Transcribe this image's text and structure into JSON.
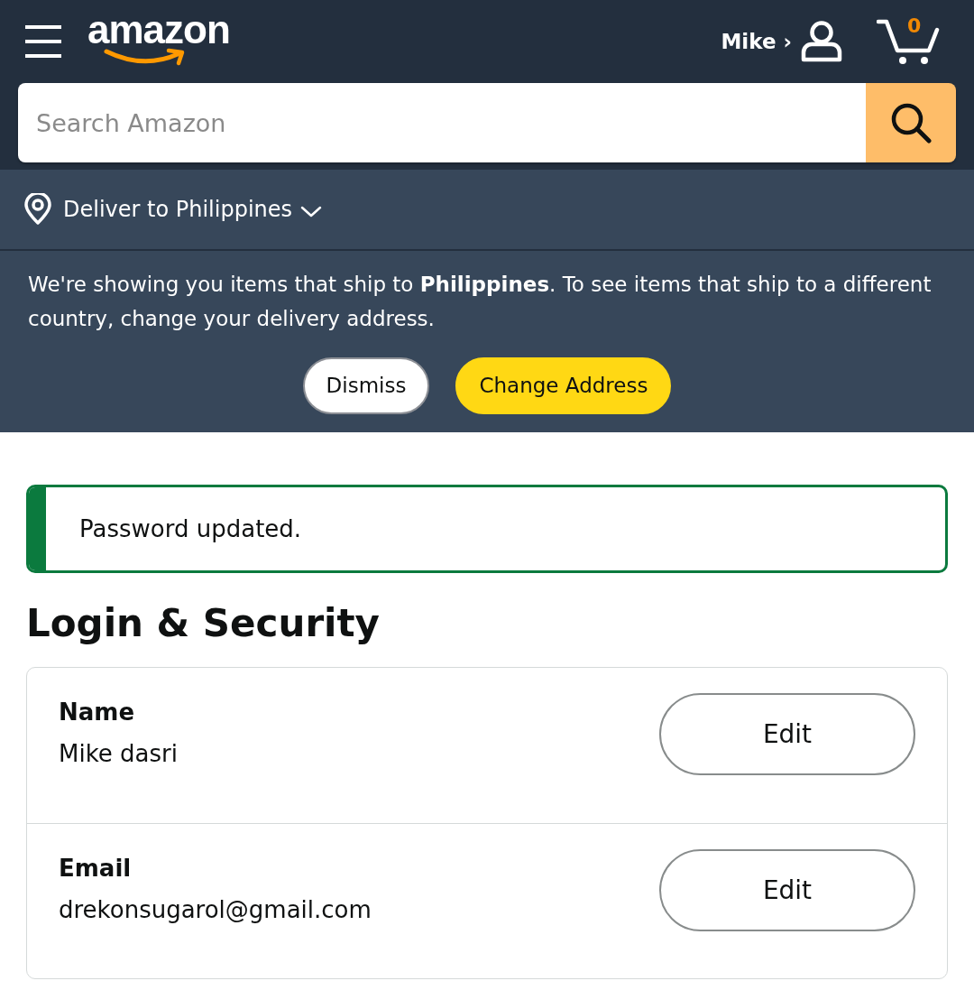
{
  "header": {
    "logo": "amazon",
    "account": "Mike ›",
    "cart_count": "0"
  },
  "search": {
    "placeholder": "Search Amazon"
  },
  "delivery": {
    "label": "Deliver to Philippines"
  },
  "location_notice": {
    "message": "We're showing you items that ship to **Philippines**. To see items that ship to a different country, change your delivery address.",
    "buttons": [
      {
        "label": "Dismiss",
        "kind": "secondary"
      },
      {
        "label": "Change Address",
        "kind": "primary"
      }
    ]
  },
  "alert": {
    "kind": "success",
    "message": "Password updated."
  },
  "page_title": "Login & Security",
  "settings": [
    {
      "label": "Name",
      "value": "Mike dasri",
      "button": "Edit"
    },
    {
      "label": "Email",
      "value": "drekonsugarol@gmail.com",
      "button": "Edit"
    }
  ]
}
